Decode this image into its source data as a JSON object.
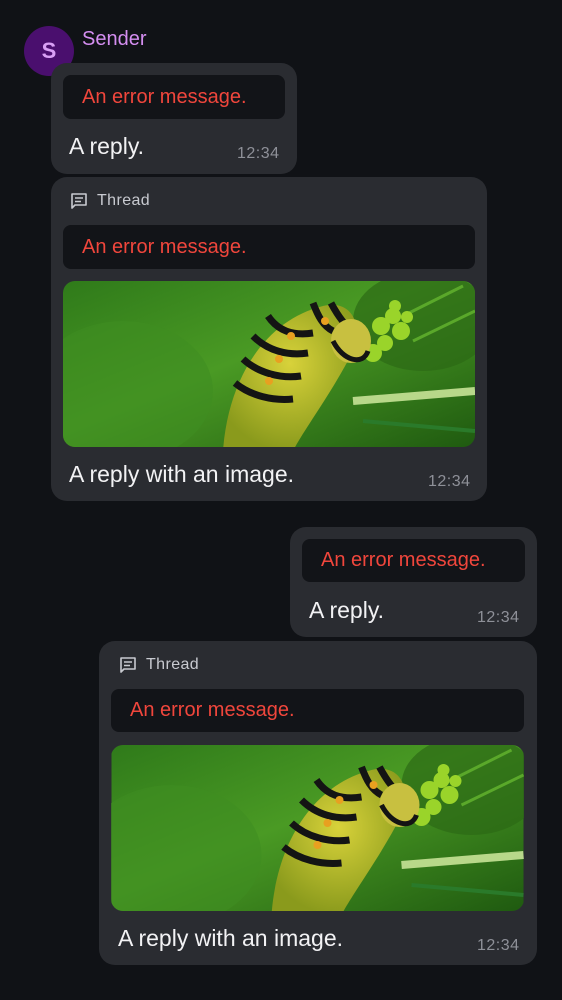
{
  "sender": {
    "initial": "S",
    "name": "Sender"
  },
  "messages": [
    {
      "reply_to": "An error message.",
      "text": "A reply.",
      "time": "12:34"
    },
    {
      "thread_label": "Thread",
      "reply_to": "An error message.",
      "image_icon": "caterpillar-photo",
      "text": "A reply with an image.",
      "time": "12:34"
    },
    {
      "reply_to": "An error message.",
      "text": "A reply.",
      "time": "12:34"
    },
    {
      "thread_label": "Thread",
      "reply_to": "An error message.",
      "image_icon": "caterpillar-photo",
      "text": "A reply with an image.",
      "time": "12:34"
    }
  ],
  "colors": {
    "background": "#101216",
    "bubble": "#2a2c31",
    "error": "#f0463c",
    "sender_name": "#d48ef0",
    "avatar": "#4a0f6e"
  }
}
